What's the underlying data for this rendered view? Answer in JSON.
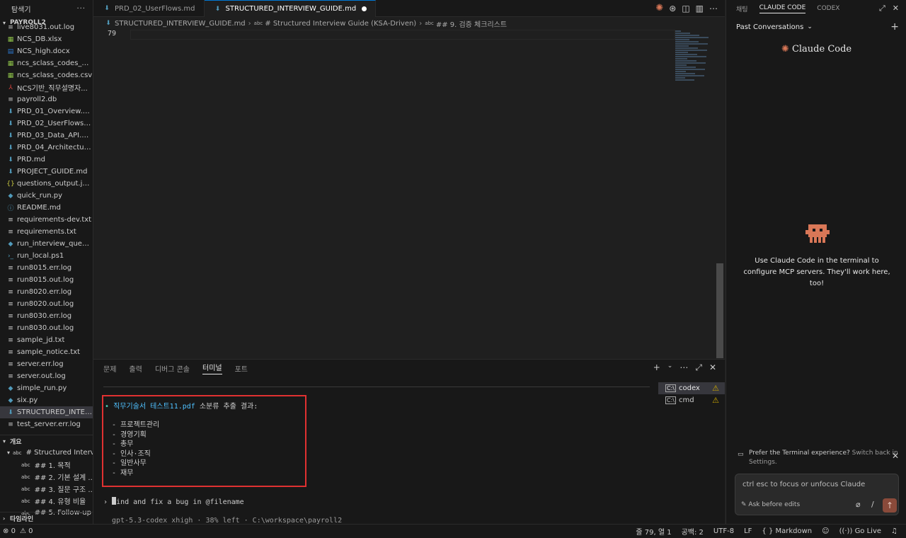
{
  "explorer": {
    "title": "탐색기",
    "more": "···",
    "root": "PAYROLL2",
    "files": [
      {
        "name": "live8031.out.log",
        "icon": "lines-icon",
        "type": "txt"
      },
      {
        "name": "NCS_DB.xlsx",
        "icon": "excel-icon",
        "type": "xlsx"
      },
      {
        "name": "NCS_high.docx",
        "icon": "word-icon",
        "type": "docx"
      },
      {
        "name": "ncs_sclass_codes_with...",
        "icon": "table-icon",
        "type": "csv"
      },
      {
        "name": "ncs_sclass_codes.csv",
        "icon": "table-icon",
        "type": "csv"
      },
      {
        "name": "NCS기반_직무설명자...",
        "icon": "pdf-icon",
        "type": "pdf"
      },
      {
        "name": "payroll2.db",
        "icon": "lines-icon",
        "type": "db"
      },
      {
        "name": "PRD_01_Overview.md",
        "icon": "markdown-icon",
        "type": "md"
      },
      {
        "name": "PRD_02_UserFlows.md",
        "icon": "markdown-icon",
        "type": "md"
      },
      {
        "name": "PRD_03_Data_API.md",
        "icon": "markdown-icon",
        "type": "md"
      },
      {
        "name": "PRD_04_Architecture....",
        "icon": "markdown-icon",
        "type": "md"
      },
      {
        "name": "PRD.md",
        "icon": "markdown-icon",
        "type": "md"
      },
      {
        "name": "PROJECT_GUIDE.md",
        "icon": "markdown-icon",
        "type": "md"
      },
      {
        "name": "questions_output.json",
        "icon": "json-icon",
        "type": "json"
      },
      {
        "name": "quick_run.py",
        "icon": "python-icon",
        "type": "py"
      },
      {
        "name": "README.md",
        "icon": "info-icon",
        "type": "info"
      },
      {
        "name": "requirements-dev.txt",
        "icon": "lines-icon",
        "type": "txt"
      },
      {
        "name": "requirements.txt",
        "icon": "lines-icon",
        "type": "txt"
      },
      {
        "name": "run_interview_questio...",
        "icon": "python-icon",
        "type": "py"
      },
      {
        "name": "run_local.ps1",
        "icon": "powershell-icon",
        "type": "ps"
      },
      {
        "name": "run8015.err.log",
        "icon": "lines-icon",
        "type": "txt"
      },
      {
        "name": "run8015.out.log",
        "icon": "lines-icon",
        "type": "txt"
      },
      {
        "name": "run8020.err.log",
        "icon": "lines-icon",
        "type": "txt"
      },
      {
        "name": "run8020.out.log",
        "icon": "lines-icon",
        "type": "txt"
      },
      {
        "name": "run8030.err.log",
        "icon": "lines-icon",
        "type": "txt"
      },
      {
        "name": "run8030.out.log",
        "icon": "lines-icon",
        "type": "txt"
      },
      {
        "name": "sample_jd.txt",
        "icon": "lines-icon",
        "type": "txt"
      },
      {
        "name": "sample_notice.txt",
        "icon": "lines-icon",
        "type": "txt"
      },
      {
        "name": "server.err.log",
        "icon": "lines-icon",
        "type": "txt"
      },
      {
        "name": "server.out.log",
        "icon": "lines-icon",
        "type": "txt"
      },
      {
        "name": "simple_run.py",
        "icon": "python-icon",
        "type": "py"
      },
      {
        "name": "six.py",
        "icon": "python-icon",
        "type": "py"
      },
      {
        "name": "STRUCTURED_INTERVI...",
        "icon": "markdown-icon",
        "type": "md",
        "selected": true
      },
      {
        "name": "test_server.err.log",
        "icon": "lines-icon",
        "type": "txt"
      }
    ],
    "outline_title": "개요",
    "outline": [
      {
        "text": "# Structured Interv...",
        "indent": 1
      },
      {
        "text": "## 1. 목적",
        "indent": 2
      },
      {
        "text": "## 2. 기본 설계 ...",
        "indent": 2
      },
      {
        "text": "## 3. 질문 구조 ...",
        "indent": 2
      },
      {
        "text": "## 4. 유형 비율",
        "indent": 2
      },
      {
        "text": "## 5. Follow-up",
        "indent": 2
      }
    ],
    "timeline_title": "타임라인"
  },
  "tabs": [
    {
      "label": "PRD_02_UserFlows.md",
      "active": false
    },
    {
      "label": "STRUCTURED_INTERVIEW_GUIDE.md",
      "active": true,
      "dirty": true
    }
  ],
  "breadcrumb": {
    "file": "STRUCTURED_INTERVIEW_GUIDE.md",
    "h1": "# Structured Interview Guide (KSA-Driven)",
    "h2": "## 9. 검증 체크리스트"
  },
  "editor": {
    "line_number": "79"
  },
  "panel": {
    "tabs": [
      "문제",
      "출력",
      "디버그 콘솔",
      "터미널",
      "포트"
    ],
    "active_tab": "터미널"
  },
  "terminal": {
    "bullet": "•",
    "file_label": "직무기술서 테스트11.pdf",
    "heading_rest": " 소분류 추출 결과:",
    "items": [
      "- 프로젝트관리",
      "- 경영기획",
      "- 총무",
      "- 인사·조직",
      "- 일반사무",
      "- 재무"
    ],
    "prompt_arrow": "›",
    "prompt_first_char": "F",
    "prompt_rest": "ind and fix a bug in @filename",
    "footer": "gpt-5.3-codex xhigh · 38% left · C:\\workspace\\payroll2"
  },
  "terminals": [
    {
      "name": "codex",
      "active": true
    },
    {
      "name": "cmd",
      "active": false
    }
  ],
  "claude": {
    "tabs": [
      "채팅",
      "CLAUDE CODE",
      "CODEX"
    ],
    "active_tab": "CLAUDE CODE",
    "past_conversations": "Past Conversations",
    "logo_text": "Claude Code",
    "mcp_note": "Use Claude Code in the terminal to configure MCP servers. They'll work here, too!",
    "pref_text": "Prefer the Terminal experience?",
    "pref_link": "Switch back in Settings.",
    "input_placeholder": "ctrl esc to focus or unfocus Claude",
    "mode_label": "Ask before edits",
    "slash": "/"
  },
  "statusbar": {
    "errors": "0",
    "warnings": "0",
    "position": "줄 79, 열 1",
    "spaces": "공백: 2",
    "encoding": "UTF-8",
    "eol": "LF",
    "language": "Markdown",
    "golive": "Go Live"
  }
}
